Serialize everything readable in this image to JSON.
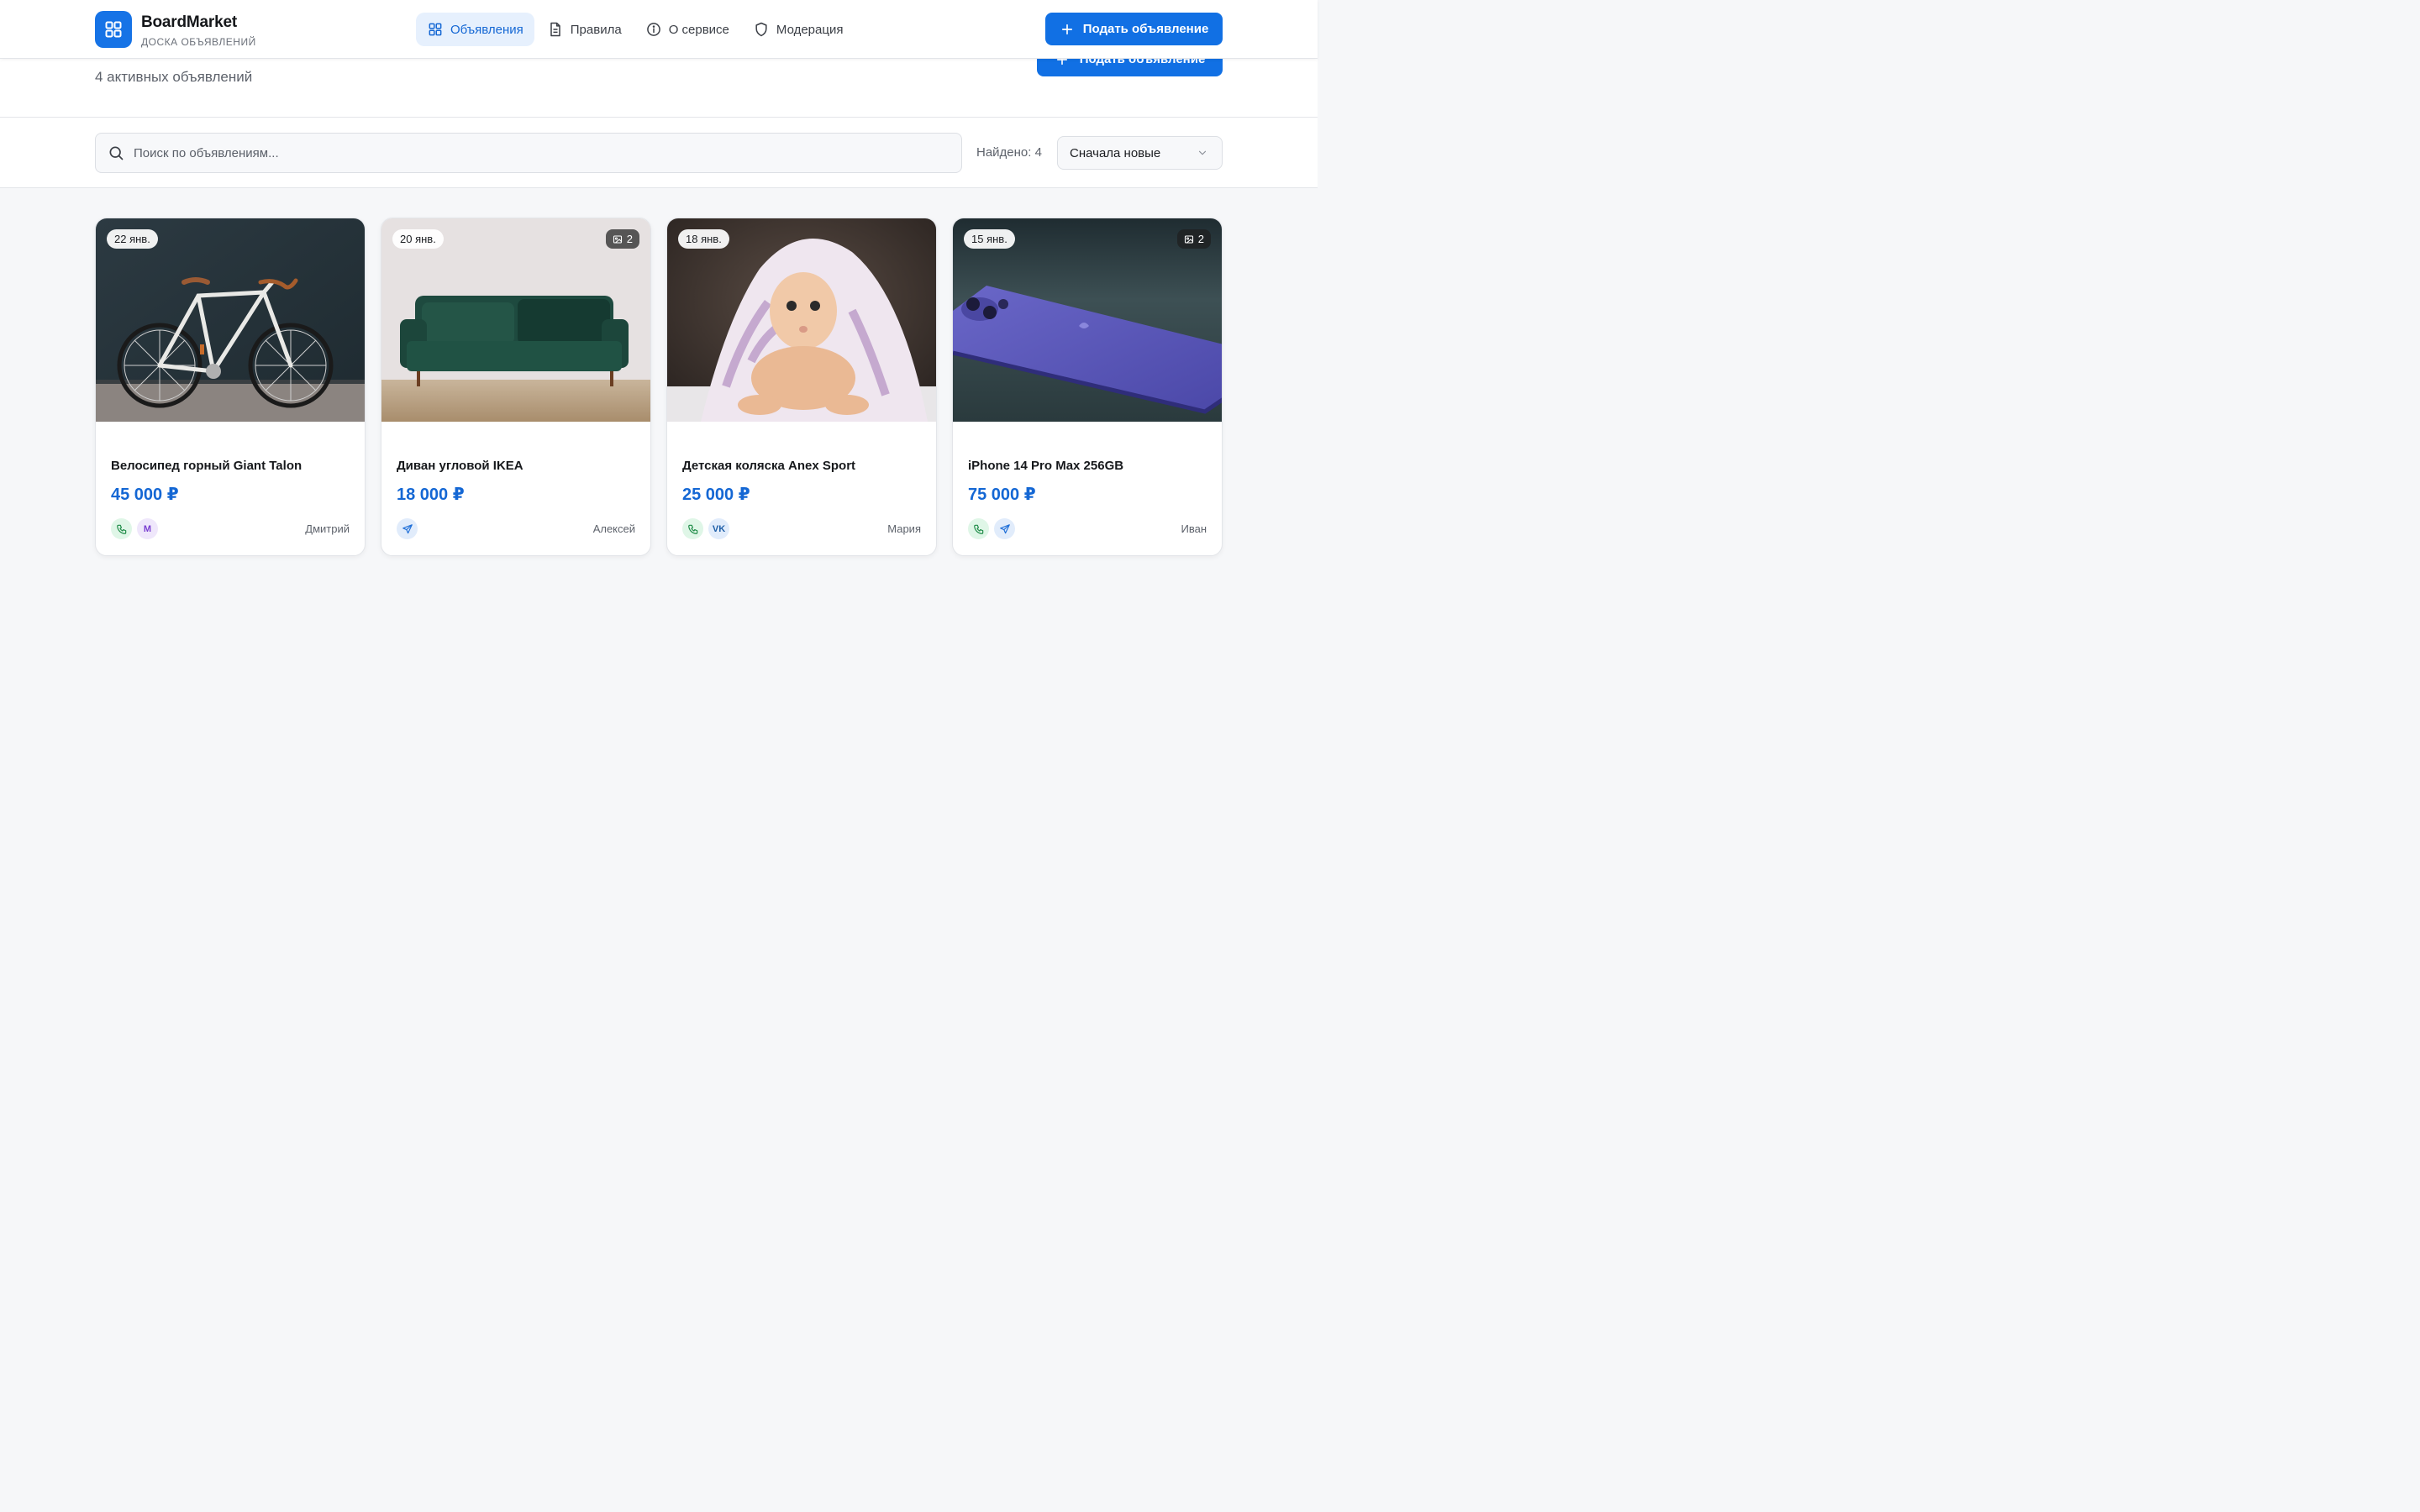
{
  "header": {
    "brand_name": "BoardMarket",
    "brand_tagline": "ДОСКА ОБЪЯВЛЕНИЙ",
    "nav": [
      {
        "label": "Объявления",
        "icon": "grid-icon",
        "active": true
      },
      {
        "label": "Правила",
        "icon": "document-icon",
        "active": false
      },
      {
        "label": "О сервисе",
        "icon": "info-icon",
        "active": false
      },
      {
        "label": "Модерация",
        "icon": "shield-icon",
        "active": false
      }
    ],
    "post_button": "Подать объявление"
  },
  "subheader": {
    "count_text": "4 активных объявлений",
    "post_button": "Подать объявление"
  },
  "filters": {
    "search_placeholder": "Поиск по объявлениям...",
    "found_text": "Найдено: 4",
    "sort_value": "Сначала новые"
  },
  "colors": {
    "accent": "#1170e4",
    "price": "#1467d4",
    "background": "#f6f7f9"
  },
  "listings": [
    {
      "date": "22 янв.",
      "image_count": "",
      "title": "Велосипед горный Giant Talon",
      "price": "45 000 ₽",
      "seller": "Дмитрий",
      "contacts": [
        "phone",
        "max"
      ],
      "photo": "bicycle"
    },
    {
      "date": "20 янв.",
      "image_count": "2",
      "title": "Диван угловой IKEA",
      "price": "18 000 ₽",
      "seller": "Алексей",
      "contacts": [
        "telegram"
      ],
      "photo": "sofa"
    },
    {
      "date": "18 янв.",
      "image_count": "",
      "title": "Детская коляска Anex Sport",
      "price": "25 000 ₽",
      "seller": "Мария",
      "contacts": [
        "phone",
        "vk"
      ],
      "photo": "baby"
    },
    {
      "date": "15 янв.",
      "image_count": "2",
      "title": "iPhone 14 Pro Max 256GB",
      "price": "75 000 ₽",
      "seller": "Иван",
      "contacts": [
        "phone",
        "telegram"
      ],
      "photo": "phone"
    }
  ],
  "contact_labels": {
    "max": "M",
    "vk": "VK"
  }
}
